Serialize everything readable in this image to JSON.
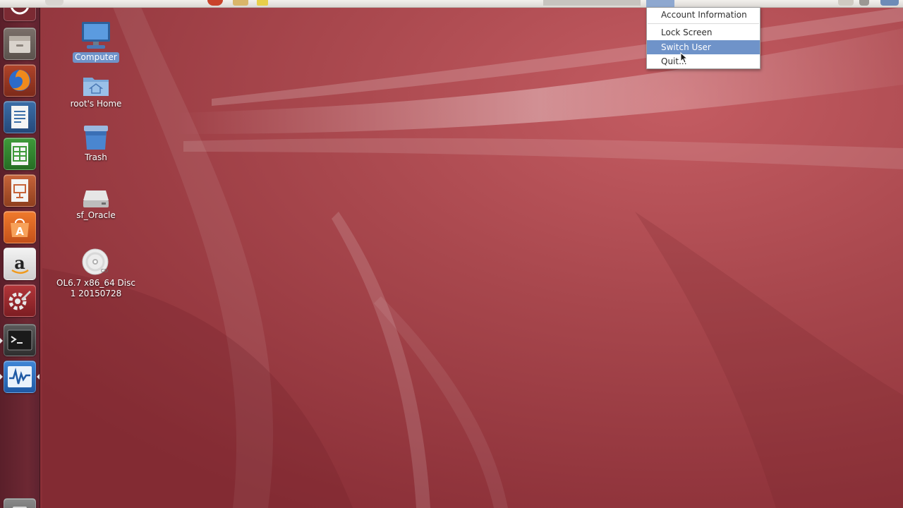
{
  "desktop": {
    "icons": [
      {
        "label": "Computer",
        "icon": "computer-icon",
        "selected": true
      },
      {
        "label": "root's Home",
        "icon": "home-folder-icon",
        "selected": false
      },
      {
        "label": "Trash",
        "icon": "trash-icon",
        "selected": false
      },
      {
        "label": "sf_Oracle",
        "icon": "drive-icon",
        "selected": false
      },
      {
        "label": "OL6.7 x86_64 Disc\n1 20150728",
        "icon": "cd-disc-icon",
        "selected": false
      }
    ]
  },
  "launcher": {
    "items": [
      {
        "icon": "dash-home-icon"
      },
      {
        "icon": "file-manager-icon"
      },
      {
        "icon": "firefox-icon"
      },
      {
        "icon": "libreoffice-writer-icon"
      },
      {
        "icon": "libreoffice-calc-icon"
      },
      {
        "icon": "libreoffice-impress-icon"
      },
      {
        "icon": "software-center-icon"
      },
      {
        "icon": "amazon-icon"
      },
      {
        "icon": "system-settings-icon"
      },
      {
        "icon": "terminal-icon"
      },
      {
        "icon": "system-monitor-icon"
      },
      {
        "icon": "trash-icon"
      }
    ]
  },
  "user_menu": {
    "items": [
      {
        "label": "Account Information",
        "highlighted": false
      },
      {
        "label": "Lock Screen",
        "highlighted": false
      },
      {
        "label": "Switch User",
        "highlighted": true
      },
      {
        "label": "Quit...",
        "highlighted": false
      }
    ]
  },
  "colors": {
    "wallpaper_base": "#a8474d",
    "launcher_bg": "#6d2833",
    "selection_highlight": "#6f93c9",
    "panel_bg": "#e6e3df"
  }
}
